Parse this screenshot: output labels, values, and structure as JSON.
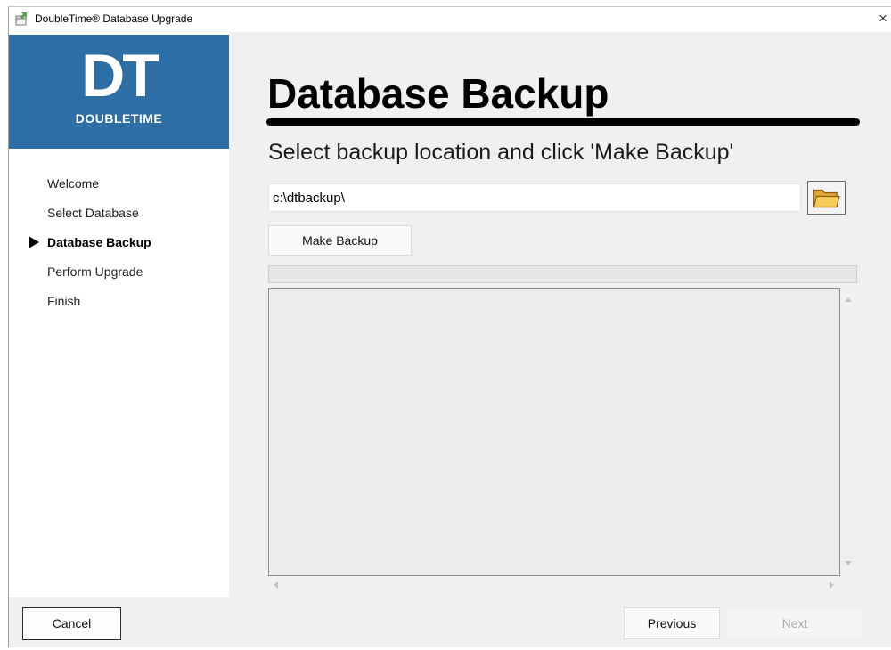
{
  "window": {
    "title": "DoubleTime® Database Upgrade",
    "close_label": "×"
  },
  "logo": {
    "mark": "DT",
    "name": "DOUBLETIME",
    "background_color": "#2e6ea6"
  },
  "sidebar": {
    "steps": [
      {
        "label": "Welcome",
        "active": false
      },
      {
        "label": "Select Database",
        "active": false
      },
      {
        "label": "Database Backup",
        "active": true
      },
      {
        "label": "Perform Upgrade",
        "active": false
      },
      {
        "label": "Finish",
        "active": false
      }
    ]
  },
  "main": {
    "title": "Database Backup",
    "subtitle": "Select backup location and click 'Make Backup'",
    "backup_path": "c:\\dtbackup\\",
    "browse_icon": "folder-icon",
    "make_backup_label": "Make Backup",
    "progress_percent": 0,
    "log_text": ""
  },
  "footer": {
    "cancel_label": "Cancel",
    "previous_label": "Previous",
    "next_label": "Next",
    "next_enabled": false
  }
}
